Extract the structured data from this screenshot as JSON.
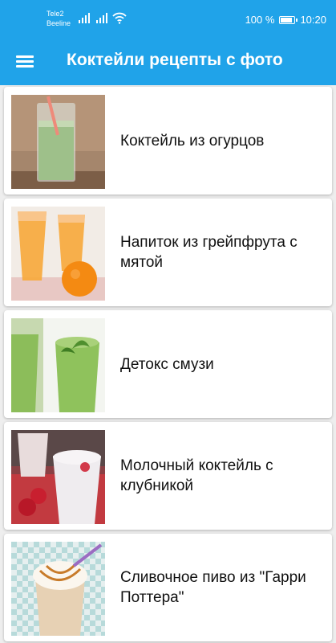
{
  "status_bar": {
    "carrier_1": "Tele2",
    "carrier_2": "Beeline",
    "battery": "100 %",
    "battery_level": 1.0,
    "time": "10:20"
  },
  "app_bar": {
    "title": "Коктейли рецепты с фото",
    "menu_icon": "hamburger-menu-icon"
  },
  "colors": {
    "primary": "#20a3e9",
    "background": "#eeeeee",
    "card": "#ffffff"
  },
  "recipes": [
    {
      "title": "Коктейль из огурцов"
    },
    {
      "title": "Напиток из грейпфрута с мятой"
    },
    {
      "title": "Детокс смузи"
    },
    {
      "title": "Молочный коктейль с клубникой"
    },
    {
      "title": "Сливочное пиво из \"Гарри Поттера\""
    }
  ]
}
